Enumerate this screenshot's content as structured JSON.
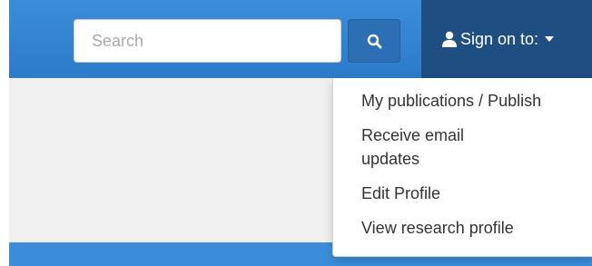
{
  "search": {
    "placeholder": "Search",
    "value": "",
    "button_icon": "search-icon"
  },
  "account": {
    "icon": "user-icon",
    "label": "Sign on to:",
    "caret_icon": "caret-down-icon"
  },
  "dropdown": {
    "items": [
      {
        "label": "My publications / Publish"
      },
      {
        "label": "Receive email updates"
      },
      {
        "label": "Edit Profile"
      },
      {
        "label": "View research profile"
      }
    ]
  },
  "colors": {
    "topbar": "#3c8dd9",
    "signon_bg": "#1f4e82",
    "search_button": "#2c6fb5",
    "content_bg": "#f0f0f0"
  }
}
